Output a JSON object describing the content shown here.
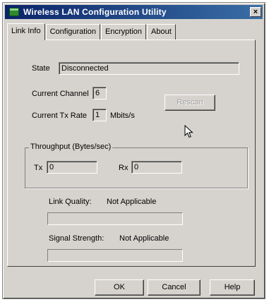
{
  "window": {
    "title": "Wireless LAN Configuration Utility",
    "close_glyph": "×"
  },
  "tabs": [
    {
      "label": "Link Info"
    },
    {
      "label": "Configuration"
    },
    {
      "label": "Encryption"
    },
    {
      "label": "About"
    }
  ],
  "link_info": {
    "state_label": "State",
    "state_value": "Disconnected",
    "channel_label": "Current Channel",
    "channel_value": "6",
    "txrate_label": "Current Tx Rate",
    "txrate_value": "1",
    "txrate_unit": "Mbits/s",
    "rescan_label": "Rescan",
    "throughput": {
      "title": "Throughput (Bytes/sec)",
      "tx_label": "Tx",
      "tx_value": "0",
      "rx_label": "Rx",
      "rx_value": "0"
    },
    "link_quality_label": "Link Quality:",
    "link_quality_value": "Not Applicable",
    "signal_strength_label": "Signal Strength:",
    "signal_strength_value": "Not Applicable"
  },
  "buttons": {
    "ok": "OK",
    "cancel": "Cancel",
    "help": "Help"
  },
  "colors": {
    "title_start": "#0a246a",
    "title_end": "#3a6ea5",
    "face": "#d6d3ce"
  }
}
